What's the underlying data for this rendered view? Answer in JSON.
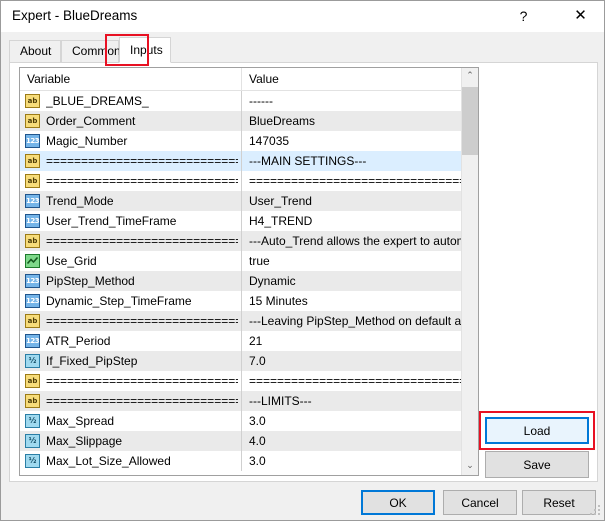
{
  "window": {
    "title": "Expert - BlueDreams",
    "help_label": "?",
    "close_label": "✕"
  },
  "tabs": [
    {
      "label": "About",
      "selected": false
    },
    {
      "label": "Common",
      "selected": false
    },
    {
      "label": "Inputs",
      "selected": true
    }
  ],
  "table": {
    "headers": {
      "variable": "Variable",
      "value": "Value"
    },
    "rows": [
      {
        "icon": "string-icon",
        "icon_glyph": "ab",
        "variable": "_BLUE_DREAMS_",
        "value": "------",
        "highlight": false
      },
      {
        "icon": "string-icon",
        "icon_glyph": "ab",
        "variable": "Order_Comment",
        "value": "BlueDreams",
        "highlight": false
      },
      {
        "icon": "integer-icon",
        "icon_glyph": "123",
        "variable": "Magic_Number",
        "value": "147035",
        "highlight": false
      },
      {
        "icon": "string-icon",
        "icon_glyph": "ab",
        "variable": "==============================...",
        "value": "---MAIN SETTINGS---",
        "highlight": true
      },
      {
        "icon": "string-icon",
        "icon_glyph": "ab",
        "variable": "==============================...",
        "value": "==================================...",
        "highlight": false
      },
      {
        "icon": "integer-icon",
        "icon_glyph": "123",
        "variable": "Trend_Mode",
        "value": "User_Trend",
        "highlight": false
      },
      {
        "icon": "integer-icon",
        "icon_glyph": "123",
        "variable": "User_Trend_TimeFrame",
        "value": "H4_TREND",
        "highlight": false
      },
      {
        "icon": "string-icon",
        "icon_glyph": "ab",
        "variable": "==============================...",
        "value": "---Auto_Trend allows the expert to automati...",
        "highlight": false
      },
      {
        "icon": "bool-icon",
        "icon_glyph": "",
        "variable": "Use_Grid",
        "value": "true",
        "highlight": false
      },
      {
        "icon": "integer-icon",
        "icon_glyph": "123",
        "variable": "PipStep_Method",
        "value": "Dynamic",
        "highlight": false
      },
      {
        "icon": "integer-icon",
        "icon_glyph": "123",
        "variable": "Dynamic_Step_TimeFrame",
        "value": "15 Minutes",
        "highlight": false
      },
      {
        "icon": "string-icon",
        "icon_glyph": "ab",
        "variable": "==============================...",
        "value": "---Leaving PipStep_Method on default allo...",
        "highlight": false
      },
      {
        "icon": "integer-icon",
        "icon_glyph": "123",
        "variable": "ATR_Period",
        "value": "21",
        "highlight": false
      },
      {
        "icon": "float-icon",
        "icon_glyph": "½",
        "variable": "If_Fixed_PipStep",
        "value": "7.0",
        "highlight": false
      },
      {
        "icon": "string-icon",
        "icon_glyph": "ab",
        "variable": "==============================...",
        "value": "==================================...",
        "highlight": false
      },
      {
        "icon": "string-icon",
        "icon_glyph": "ab",
        "variable": "==============================...",
        "value": "---LIMITS---",
        "highlight": false
      },
      {
        "icon": "float-icon",
        "icon_glyph": "½",
        "variable": "Max_Spread",
        "value": "3.0",
        "highlight": false
      },
      {
        "icon": "float-icon",
        "icon_glyph": "½",
        "variable": "Max_Slippage",
        "value": "4.0",
        "highlight": false
      },
      {
        "icon": "float-icon",
        "icon_glyph": "½",
        "variable": "Max_Lot_Size_Allowed",
        "value": "3.0",
        "highlight": false
      }
    ]
  },
  "scrollbar": {
    "up_glyph": "⌃",
    "down_glyph": "⌄"
  },
  "side_buttons": {
    "load": "Load",
    "save": "Save"
  },
  "bottom_buttons": {
    "ok": "OK",
    "cancel": "Cancel",
    "reset": "Reset"
  },
  "annotations": {
    "highlight_color": "#e81123",
    "focus_color": "#0078d7",
    "selection_color": "#dbeeff"
  }
}
